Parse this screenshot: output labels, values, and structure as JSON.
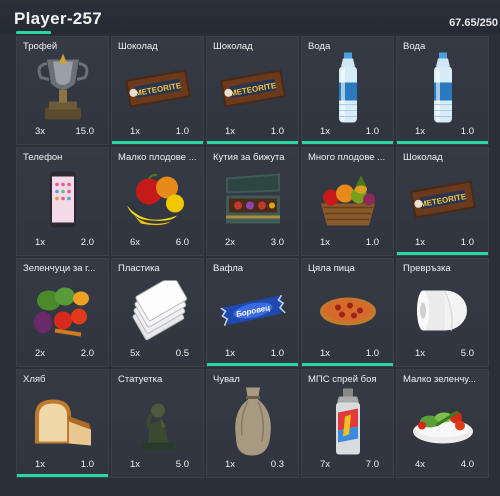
{
  "header": {
    "player_name": "Player-257",
    "weight_text": "67.65/250",
    "weight_fraction": 0.27,
    "accent": "#29d7a3"
  },
  "slots": [
    {
      "name": "Трофей",
      "qty": "3x",
      "weight": "15.0",
      "icon": "trophy-icon",
      "bar": false
    },
    {
      "name": "Шоколад",
      "qty": "1x",
      "weight": "1.0",
      "icon": "chocolate-bar-icon",
      "bar": true
    },
    {
      "name": "Шоколад",
      "qty": "1x",
      "weight": "1.0",
      "icon": "chocolate-bar-icon",
      "bar": true
    },
    {
      "name": "Вода",
      "qty": "1x",
      "weight": "1.0",
      "icon": "water-bottle-icon",
      "bar": true
    },
    {
      "name": "Вода",
      "qty": "1x",
      "weight": "1.0",
      "icon": "water-bottle-icon",
      "bar": true
    },
    {
      "name": "Телефон",
      "qty": "1x",
      "weight": "2.0",
      "icon": "phone-icon",
      "bar": false
    },
    {
      "name": "Малко плодове ...",
      "qty": "6x",
      "weight": "6.0",
      "icon": "fruit-pile-icon",
      "bar": false
    },
    {
      "name": "Кутия за бижута",
      "qty": "2x",
      "weight": "3.0",
      "icon": "jewelry-box-icon",
      "bar": false
    },
    {
      "name": "Много плодове ...",
      "qty": "1x",
      "weight": "1.0",
      "icon": "fruit-basket-icon",
      "bar": false
    },
    {
      "name": "Шоколад",
      "qty": "1x",
      "weight": "1.0",
      "icon": "chocolate-bar-icon",
      "bar": true
    },
    {
      "name": "Зеленчуци за г...",
      "qty": "2x",
      "weight": "2.0",
      "icon": "vegetables-icon",
      "bar": false
    },
    {
      "name": "Пластика",
      "qty": "5x",
      "weight": "0.5",
      "icon": "plastic-cards-icon",
      "bar": false
    },
    {
      "name": "Вафла",
      "qty": "1x",
      "weight": "1.0",
      "icon": "wafer-icon",
      "bar": true
    },
    {
      "name": "Цяла пица",
      "qty": "1x",
      "weight": "1.0",
      "icon": "pizza-icon",
      "bar": true
    },
    {
      "name": "Превръзка",
      "qty": "1x",
      "weight": "5.0",
      "icon": "bandage-roll-icon",
      "bar": false
    },
    {
      "name": "Хляб",
      "qty": "1x",
      "weight": "1.0",
      "icon": "bread-icon",
      "bar": true
    },
    {
      "name": "Статуетка",
      "qty": "1x",
      "weight": "5.0",
      "icon": "statuette-icon",
      "bar": false
    },
    {
      "name": "Чувал",
      "qty": "1x",
      "weight": "0.3",
      "icon": "sack-icon",
      "bar": false
    },
    {
      "name": "МПС спрей боя",
      "qty": "7x",
      "weight": "7.0",
      "icon": "spray-paint-icon",
      "bar": false
    },
    {
      "name": "Малко зеленчу...",
      "qty": "4x",
      "weight": "4.0",
      "icon": "vegetable-bowl-icon",
      "bar": false
    }
  ]
}
